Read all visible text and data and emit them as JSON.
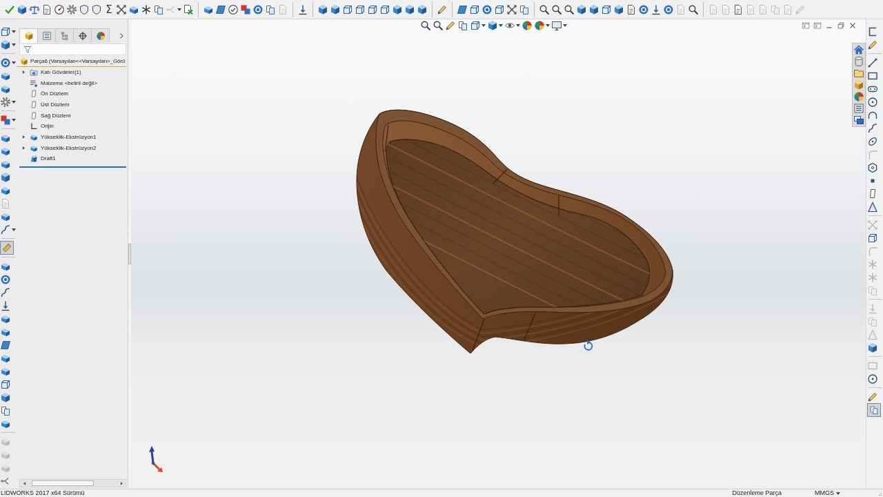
{
  "toolbar": {
    "groups": [
      [
        {
          "disabled": false,
          "dropdown": false
        },
        {
          "disabled": false,
          "dropdown": false
        },
        {
          "disabled": false,
          "dropdown": false
        },
        {
          "disabled": false,
          "dropdown": false
        },
        {
          "disabled": false,
          "dropdown": false
        },
        {
          "disabled": false,
          "dropdown": false
        },
        {
          "disabled": false,
          "dropdown": false
        },
        {
          "disabled": false,
          "dropdown": false
        },
        {
          "label": "Σ",
          "disabled": false,
          "dropdown": false
        },
        {
          "disabled": false,
          "dropdown": false
        },
        {
          "disabled": false,
          "dropdown": false
        },
        {
          "disabled": false,
          "dropdown": false
        },
        {
          "disabled": false,
          "dropdown": false
        },
        {
          "disabled": true,
          "dropdown": true
        },
        {
          "disabled": false,
          "dropdown": false
        }
      ],
      [
        {
          "disabled": false,
          "dropdown": false
        },
        {
          "disabled": false,
          "dropdown": false
        },
        {
          "disabled": false,
          "dropdown": false
        },
        {
          "disabled": false,
          "dropdown": false
        },
        {
          "disabled": false,
          "dropdown": false
        },
        {
          "disabled": false,
          "dropdown": false
        },
        {
          "disabled": true,
          "dropdown": false
        }
      ],
      [
        {
          "disabled": false,
          "dropdown": false
        }
      ],
      [
        {
          "disabled": false,
          "dropdown": false
        },
        {
          "disabled": false,
          "dropdown": false
        },
        {
          "disabled": false,
          "dropdown": false
        },
        {
          "disabled": false,
          "dropdown": false
        },
        {
          "disabled": false,
          "dropdown": false
        },
        {
          "disabled": false,
          "dropdown": false
        },
        {
          "disabled": false,
          "dropdown": false
        },
        {
          "disabled": false,
          "dropdown": false
        },
        {
          "disabled": false,
          "dropdown": false
        }
      ],
      [
        {
          "disabled": false,
          "dropdown": false
        }
      ],
      [
        {
          "disabled": false,
          "dropdown": false
        },
        {
          "disabled": false,
          "dropdown": false
        },
        {
          "disabled": false,
          "dropdown": false
        },
        {
          "disabled": false,
          "dropdown": false
        },
        {
          "disabled": false,
          "dropdown": false
        },
        {
          "disabled": false,
          "dropdown": false
        }
      ],
      [
        {
          "disabled": false,
          "dropdown": false
        },
        {
          "disabled": false,
          "dropdown": false
        },
        {
          "disabled": false,
          "dropdown": false
        },
        {
          "disabled": false,
          "dropdown": false
        },
        {
          "disabled": false,
          "dropdown": false
        },
        {
          "disabled": false,
          "dropdown": false
        },
        {
          "disabled": false,
          "dropdown": false
        },
        {
          "disabled": false,
          "dropdown": false
        },
        {
          "disabled": false,
          "dropdown": false
        },
        {
          "disabled": false,
          "dropdown": false
        },
        {
          "disabled": false,
          "dropdown": false
        },
        {
          "disabled": true,
          "dropdown": false
        },
        {
          "disabled": false,
          "dropdown": false
        }
      ],
      [
        {
          "disabled": true,
          "dropdown": false
        },
        {
          "disabled": true,
          "dropdown": false
        },
        {
          "disabled": false,
          "dropdown": false
        },
        {
          "disabled": true,
          "dropdown": false
        },
        {
          "disabled": true,
          "dropdown": false
        },
        {
          "disabled": true,
          "dropdown": false
        },
        {
          "disabled": true,
          "dropdown": false
        },
        {
          "disabled": true,
          "dropdown": false
        }
      ]
    ]
  },
  "heads_up_toolbar": {
    "items": [
      {
        "dropdown": false
      },
      {
        "dropdown": false
      },
      {
        "dropdown": false
      },
      {
        "dropdown": false
      },
      {
        "dropdown": true
      },
      {
        "dropdown": true
      },
      {
        "dropdown": true
      },
      {
        "dropdown": false
      },
      {
        "dropdown": true
      },
      {
        "dropdown": true
      }
    ]
  },
  "left_toolbar": {
    "groups": [
      [
        {
          "disabled": false,
          "pressed": false,
          "dropdown": true
        },
        {
          "disabled": false,
          "pressed": false,
          "dropdown": true
        }
      ],
      [
        {
          "disabled": false,
          "pressed": false,
          "dropdown": true
        },
        {
          "disabled": false,
          "pressed": false,
          "dropdown": false
        },
        {
          "disabled": false,
          "pressed": false,
          "dropdown": false
        },
        {
          "disabled": false,
          "pressed": false,
          "dropdown": true
        }
      ],
      [
        {
          "disabled": false,
          "pressed": false,
          "dropdown": true
        }
      ],
      [
        {
          "disabled": false,
          "pressed": false,
          "dropdown": false
        },
        {
          "disabled": false,
          "pressed": false,
          "dropdown": false
        },
        {
          "disabled": false,
          "pressed": false,
          "dropdown": false
        },
        {
          "disabled": false,
          "pressed": false,
          "dropdown": false
        },
        {
          "disabled": false,
          "pressed": false,
          "dropdown": false
        },
        {
          "disabled": true,
          "pressed": false,
          "dropdown": false
        },
        {
          "disabled": false,
          "pressed": false,
          "dropdown": false
        },
        {
          "disabled": false,
          "pressed": false,
          "dropdown": true
        }
      ],
      [
        {
          "disabled": false,
          "pressed": true,
          "dropdown": false
        }
      ],
      [
        {
          "disabled": false,
          "pressed": false,
          "dropdown": false
        },
        {
          "disabled": false,
          "pressed": false,
          "dropdown": false
        },
        {
          "disabled": false,
          "pressed": false,
          "dropdown": false
        },
        {
          "disabled": false,
          "pressed": false,
          "dropdown": false
        },
        {
          "disabled": false,
          "pressed": false,
          "dropdown": false
        },
        {
          "disabled": false,
          "pressed": false,
          "dropdown": false
        },
        {
          "disabled": false,
          "pressed": false,
          "dropdown": false
        },
        {
          "disabled": false,
          "pressed": false,
          "dropdown": false
        },
        {
          "disabled": false,
          "pressed": false,
          "dropdown": false
        },
        {
          "disabled": false,
          "pressed": false,
          "dropdown": false
        },
        {
          "disabled": false,
          "pressed": false,
          "dropdown": false
        },
        {
          "disabled": false,
          "pressed": false,
          "dropdown": false
        },
        {
          "disabled": false,
          "pressed": false,
          "dropdown": false
        }
      ],
      [
        {
          "disabled": true,
          "pressed": false,
          "dropdown": false
        },
        {
          "disabled": true,
          "pressed": false,
          "dropdown": false
        },
        {
          "disabled": true,
          "pressed": false,
          "dropdown": false
        },
        {
          "disabled": false,
          "pressed": false,
          "dropdown": false
        }
      ]
    ]
  },
  "feature_manager": {
    "tabs": [
      {
        "selected": true
      },
      {
        "selected": false
      },
      {
        "selected": false
      },
      {
        "selected": false
      },
      {
        "selected": false
      }
    ],
    "tree": {
      "root": {
        "kind": "part",
        "label": "Parça6 (Varsayılan<<Varsayılan>_Görü"
      },
      "items": [
        {
          "kind": "bodies",
          "label": "Katı Gövdeler(1)",
          "expandable": true
        },
        {
          "kind": "material",
          "label": "Malzeme <belirli değil>",
          "expandable": false
        },
        {
          "kind": "plane",
          "label": "Ön Düzlem",
          "expandable": false
        },
        {
          "kind": "plane",
          "label": "Üst Düzlem",
          "expandable": false
        },
        {
          "kind": "plane",
          "label": "Sağ Düzlem",
          "expandable": false
        },
        {
          "kind": "origin",
          "label": "Orijin",
          "expandable": false
        },
        {
          "kind": "extrude",
          "label": "Yükseklik-Ekstrüzyon1",
          "expandable": true
        },
        {
          "kind": "extrude",
          "label": "Yükseklik-Ekstrüzyon2",
          "expandable": true
        },
        {
          "kind": "draft",
          "label": "Draft1",
          "expandable": false
        }
      ]
    }
  },
  "right_toolbar": {
    "groups": [
      [
        {
          "disabled": false,
          "pressed": false
        },
        {
          "disabled": false,
          "pressed": false
        }
      ],
      [
        {
          "disabled": false,
          "pressed": false
        },
        {
          "disabled": false,
          "pressed": false
        },
        {
          "disabled": false,
          "pressed": false
        },
        {
          "disabled": false,
          "pressed": false
        },
        {
          "disabled": false,
          "pressed": false
        },
        {
          "disabled": false,
          "pressed": false
        },
        {
          "disabled": false,
          "pressed": false
        },
        {
          "disabled": true,
          "pressed": false
        },
        {
          "disabled": false,
          "pressed": false
        },
        {
          "disabled": false,
          "pressed": false
        },
        {
          "disabled": false,
          "pressed": false
        },
        {
          "disabled": false,
          "pressed": false
        }
      ],
      [
        {
          "disabled": true,
          "pressed": false
        },
        {
          "disabled": false,
          "pressed": false
        },
        {
          "disabled": true,
          "pressed": false
        },
        {
          "disabled": true,
          "pressed": false
        },
        {
          "disabled": true,
          "pressed": false
        },
        {
          "disabled": true,
          "pressed": false
        }
      ],
      [
        {
          "disabled": true,
          "pressed": false
        },
        {
          "disabled": true,
          "pressed": false
        },
        {
          "disabled": true,
          "pressed": false
        },
        {
          "disabled": false,
          "pressed": false
        }
      ],
      [
        {
          "disabled": true,
          "pressed": false
        },
        {
          "disabled": false,
          "pressed": false
        }
      ],
      [
        {
          "disabled": false,
          "pressed": false
        },
        {
          "disabled": false,
          "pressed": true
        }
      ]
    ]
  },
  "status_bar": {
    "product": "LIDWORKS 2017 x64 Sürümü",
    "mode": "Düzenleme Parça",
    "units": "MMGS"
  }
}
